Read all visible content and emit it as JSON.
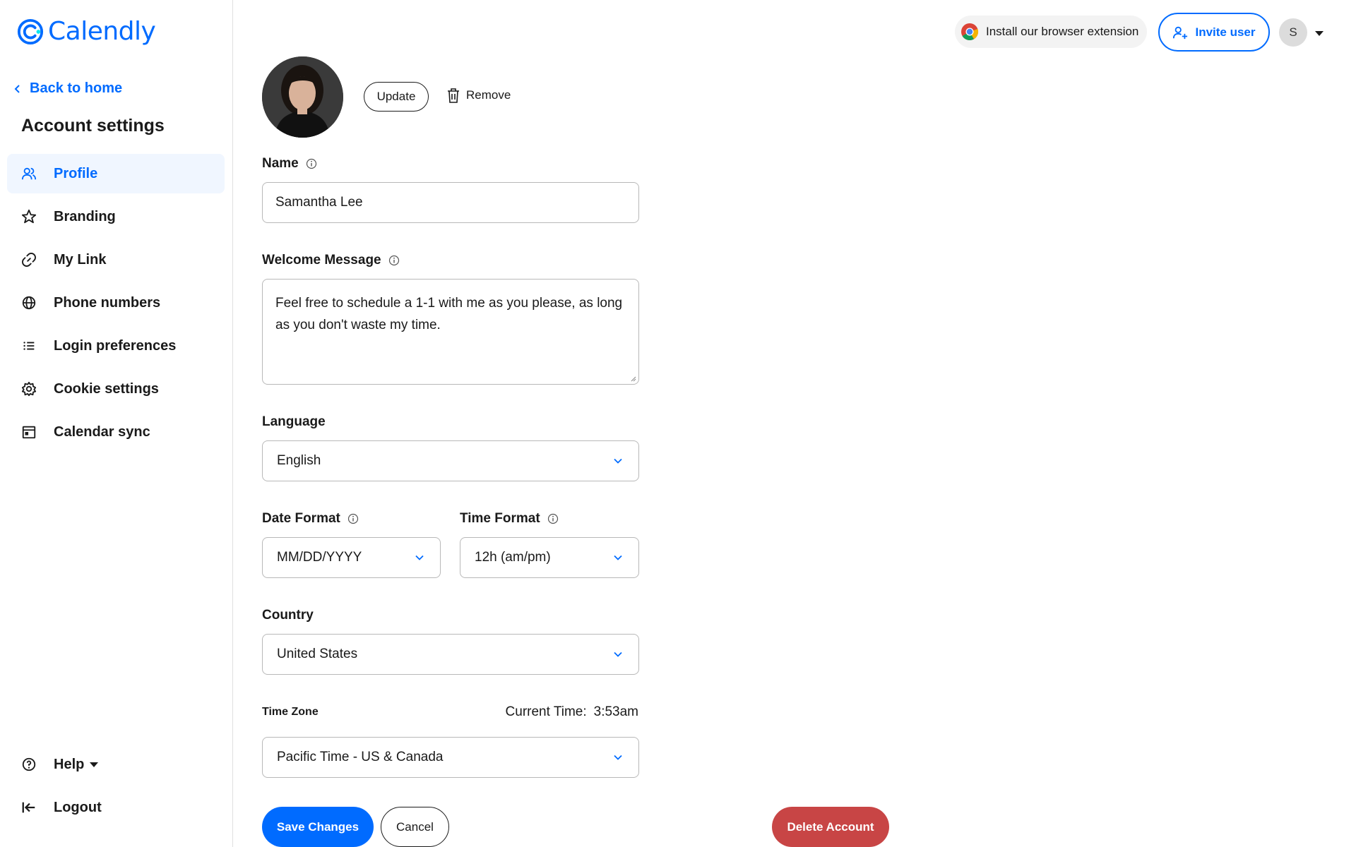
{
  "brand": {
    "name": "Calendly",
    "color": "#006bff"
  },
  "sidebar": {
    "back_label": "Back to home",
    "title": "Account settings",
    "items": [
      {
        "label": "Profile",
        "icon": "users-icon",
        "active": true
      },
      {
        "label": "Branding",
        "icon": "star-icon",
        "active": false
      },
      {
        "label": "My Link",
        "icon": "link-icon",
        "active": false
      },
      {
        "label": "Phone numbers",
        "icon": "globe-icon",
        "active": false
      },
      {
        "label": "Login preferences",
        "icon": "list-icon",
        "active": false
      },
      {
        "label": "Cookie settings",
        "icon": "gear-icon",
        "active": false
      },
      {
        "label": "Calendar sync",
        "icon": "calendar-icon",
        "active": false
      }
    ],
    "bottom": [
      {
        "label": "Help",
        "icon": "help-icon"
      },
      {
        "label": "Logout",
        "icon": "logout-icon"
      }
    ]
  },
  "topbar": {
    "extension_label": "Install our browser extension",
    "invite_label": "Invite user",
    "avatar_initial": "S"
  },
  "profile": {
    "update_label": "Update",
    "remove_label": "Remove",
    "name_label": "Name",
    "name_value": "Samantha Lee",
    "welcome_label": "Welcome Message",
    "welcome_value": "Feel free to schedule a 1-1 with me as you please, as long as you don't waste my time.",
    "language_label": "Language",
    "language_value": "English",
    "date_format_label": "Date Format",
    "date_format_value": "MM/DD/YYYY",
    "time_format_label": "Time Format",
    "time_format_value": "12h (am/pm)",
    "country_label": "Country",
    "country_value": "United States",
    "timezone_label": "Time Zone",
    "current_time_label": "Current Time:",
    "current_time_value": "3:53am",
    "timezone_value": "Pacific Time - US & Canada"
  },
  "actions": {
    "save_label": "Save Changes",
    "cancel_label": "Cancel",
    "delete_label": "Delete Account",
    "delete_color": "#c84545"
  }
}
